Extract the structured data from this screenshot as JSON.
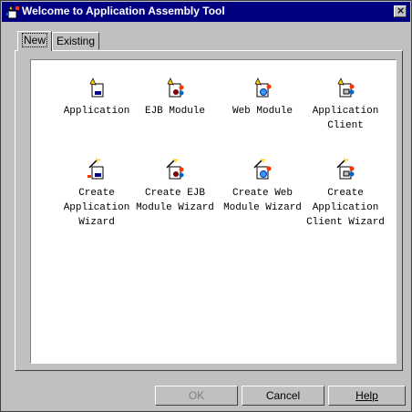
{
  "window": {
    "title": "Welcome to Application Assembly Tool",
    "close_label": "×"
  },
  "tabs": [
    {
      "label": "New"
    },
    {
      "label": "Existing"
    }
  ],
  "items": [
    {
      "label": "Application"
    },
    {
      "label": "EJB Module"
    },
    {
      "label": "Web Module"
    },
    {
      "label": "Application\nClient"
    },
    {
      "label": "Create\nApplication\nWizard"
    },
    {
      "label": "Create EJB\nModule Wizard"
    },
    {
      "label": "Create Web\nModule Wizard"
    },
    {
      "label": "Create\nApplication\nClient Wizard"
    }
  ],
  "buttons": {
    "ok": "OK",
    "cancel": "Cancel",
    "help": "Help"
  }
}
